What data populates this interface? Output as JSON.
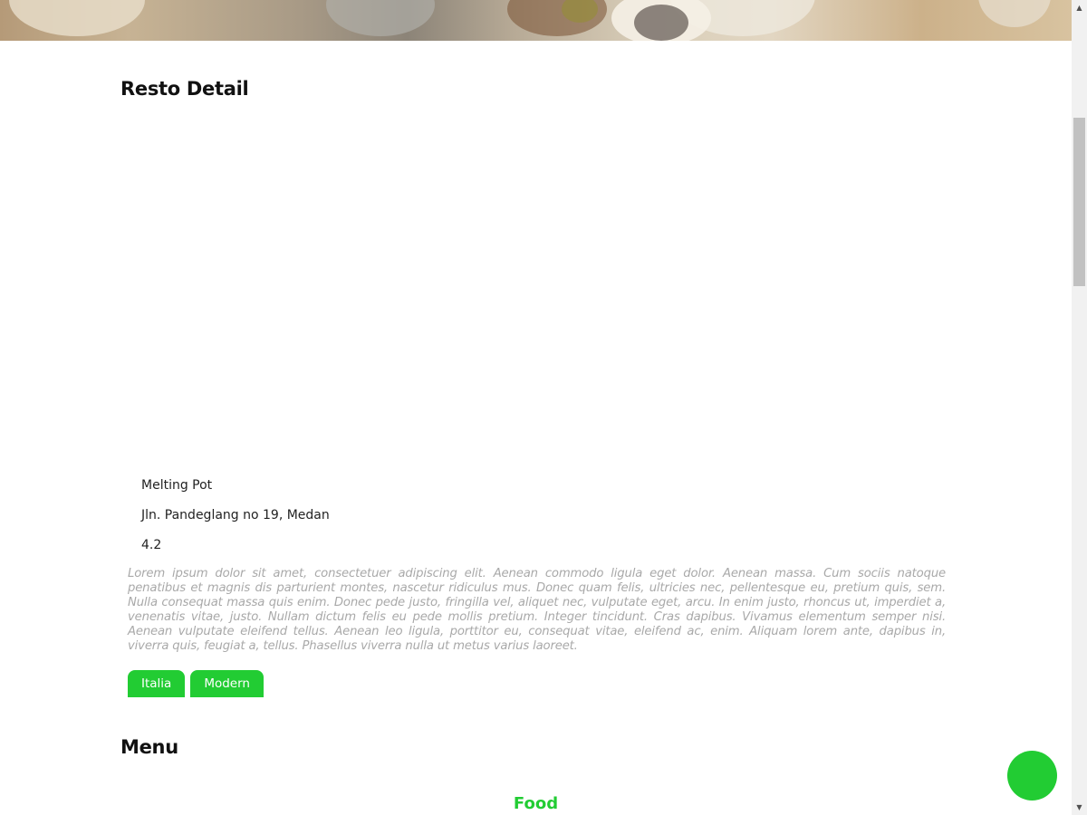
{
  "restaurant": {
    "section_title": "Resto Detail",
    "name": "Melting Pot",
    "address": "Jln. Pandeglang no 19, Medan",
    "rating": "4.2",
    "description": "Lorem ipsum dolor sit amet, consectetuer adipiscing elit. Aenean commodo ligula eget dolor. Aenean massa. Cum sociis natoque penatibus et magnis dis parturient montes, nascetur ridiculus mus. Donec quam felis, ultricies nec, pellentesque eu, pretium quis, sem. Nulla consequat massa quis enim. Donec pede justo, fringilla vel, aliquet nec, vulputate eget, arcu. In enim justo, rhoncus ut, imperdiet a, venenatis vitae, justo. Nullam dictum felis eu pede mollis pretium. Integer tincidunt. Cras dapibus. Vivamus elementum semper nisi. Aenean vulputate eleifend tellus. Aenean leo ligula, porttitor eu, consequat vitae, eleifend ac, enim. Aliquam lorem ante, dapibus in, viverra quis, feugiat a, tellus. Phasellus viverra nulla ut metus varius laoreet.",
    "categories": [
      "Italia",
      "Modern"
    ]
  },
  "menu": {
    "section_title": "Menu",
    "food_heading": "Food"
  },
  "colors": {
    "accent": "#22cc33",
    "description_text": "#a9a9a9"
  },
  "icons": {
    "fab": "favorite-button"
  }
}
